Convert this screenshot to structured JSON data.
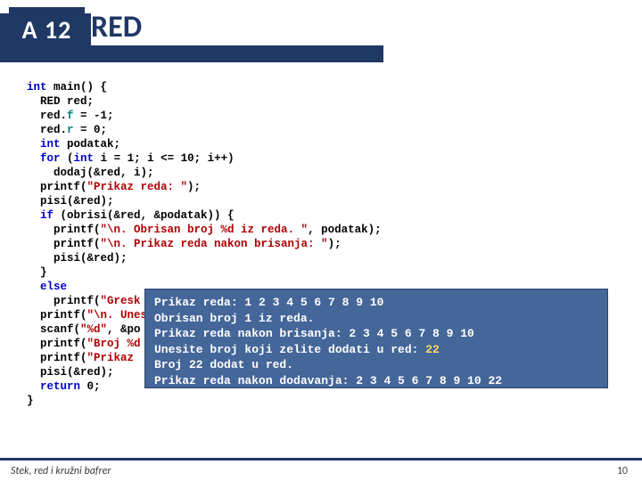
{
  "header": {
    "badge": "A 12",
    "title": "RED"
  },
  "code": {
    "l1a": "int",
    "l1b": " main() {",
    "l2a": "  RED red;",
    "l3a": "  red.",
    "l3f": "f",
    "l3b": " = -1;",
    "l4a": "  red.",
    "l4f": "r",
    "l4b": " = 0;",
    "l5a": "  ",
    "l5k": "int",
    "l5b": " podatak;",
    "l6a": "  ",
    "l6k": "for",
    "l6b": " (",
    "l6k2": "int",
    "l6c": " i = 1; i <= 10; i++)",
    "l7a": "    dodaj(&red, i);",
    "l8a": "  printf(",
    "l8s": "\"Prikaz reda: \"",
    "l8b": ");",
    "l9a": "  pisi(&red);",
    "l10a": "  ",
    "l10k": "if",
    "l10b": " (obrisi(&red, &podatak)) {",
    "l11a": "    printf(",
    "l11s": "\"\\n. Obrisan broj %d iz reda. \"",
    "l11b": ", podatak);",
    "l12a": "    printf(",
    "l12s": "\"\\n. Prikaz reda nakon brisanja: \"",
    "l12b": ");",
    "l13a": "    pisi(&red);",
    "l14a": "  }",
    "l15a": "  ",
    "l15k": "else",
    "l16a": "    printf(",
    "l16s": "\"Gresk",
    "l17a": "  printf(",
    "l17s": "\"\\n. Unesi",
    "l18a": "  scanf(",
    "l18s": "\"%d\"",
    "l18b": ", &po",
    "l19a": "  printf(",
    "l19s": "\"Broj %d",
    "l20a": "  printf(",
    "l20s": "\"Prikaz ",
    "l21a": "  pisi(&red);",
    "l22a": "  ",
    "l22k": "return",
    "l22b": " 0;",
    "l23a": "}"
  },
  "output": {
    "l1": "Prikaz reda: 1 2 3 4 5 6 7 8 9 10",
    "l2": "Obrisan broj 1 iz reda.",
    "l3": "Prikaz reda nakon brisanja: 2 3 4 5 6 7 8 9 10",
    "l4a": "Unesite broj koji zelite dodati u red: ",
    "l4b": "22",
    "l5": "Broj 22 dodat u red.",
    "l6": "Prikaz reda nakon dodavanja: 2 3 4 5 6 7 8 9 10 22"
  },
  "footer": {
    "text": "Stek, red i kružni bafrer",
    "page": "10"
  }
}
